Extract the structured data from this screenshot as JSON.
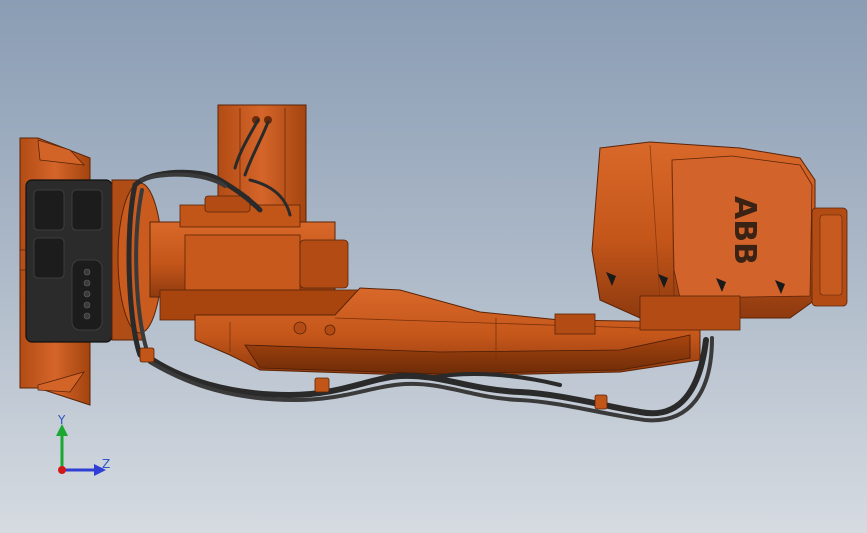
{
  "viewport": {
    "background_top": "#8a9db4",
    "background_bottom": "#d6dbe1"
  },
  "model": {
    "brand_logo": "ABB",
    "body_color": "#c85a1a",
    "body_dark_color": "#8a3c10",
    "cable_color": "#2a2a2a",
    "flange_plate_color": "#2b2b2b"
  },
  "triad": {
    "y_label": "Y",
    "z_label": "Z",
    "y_color": "#1aa832",
    "z_color": "#2f3fd6",
    "x_color": "#d01818"
  }
}
